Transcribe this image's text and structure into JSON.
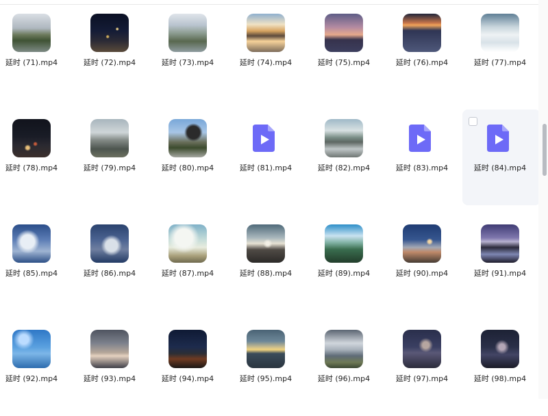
{
  "files": [
    {
      "name": "延时 (71).mp4",
      "kind": "thumb",
      "bg": "linear-gradient(180deg,#d9dee4 0%,#aeb7bf 38%,#6c7a5c 55%,#3f5334 70%,#7d8a84 100%)"
    },
    {
      "name": "延时 (72).mp4",
      "kind": "thumb",
      "bg": "radial-gradient(circle at 45% 60%,#c9a85b 0 3%,transparent 6%),radial-gradient(circle at 70% 40%,#e7cc86 0 2%,transparent 5%),linear-gradient(180deg,#0b1024 0%,#141c36 45%,#2a2a35 70%,#5a4a3a 100%)"
    },
    {
      "name": "延时 (73).mp4",
      "kind": "thumb",
      "bg": "linear-gradient(180deg,#dfe4ea 0%,#b9c4cf 30%,#8a9a8d 52%,#59684f 72%,#8f9ca0 100%)"
    },
    {
      "name": "延时 (74).mp4",
      "kind": "thumb",
      "bg": "linear-gradient(180deg,#8fb0cf 0%,#f0e2c4 28%,#d7a461 45%,#5c4a3c 58%,#f6d29a 72%,#7c6b5a 100%)"
    },
    {
      "name": "延时 (75).mp4",
      "kind": "thumb",
      "bg": "linear-gradient(180deg,#5e5d86 0%,#b28aa1 35%,#e7a98c 55%,#36324c 68%,#3d3f5e 100%)"
    },
    {
      "name": "延时 (76).mp4",
      "kind": "thumb",
      "bg": "linear-gradient(180deg,#20253a 0%,#c5744a 24%,#f1a45a 30%,#2f3554 44%,#4e587a 100%)"
    },
    {
      "name": "延时 (77).mp4",
      "kind": "thumb",
      "bg": "linear-gradient(180deg,#5f7f96 0%,#c9d6dd 35%,#eef2f4 55%,#d8e2e8 75%,#ffffff 100%)"
    },
    {
      "name": "延时 (78).mp4",
      "kind": "thumb",
      "bg": "radial-gradient(circle at 40% 75%,#e9c07a 0 4%,transparent 9%),radial-gradient(circle at 60% 65%,#c65b3a 0 3%,transparent 7%),linear-gradient(180deg,#11131c 0%,#191c26 45%,#2b2a31 70%,#3b2f2c 100%)"
    },
    {
      "name": "延时 (79).mp4",
      "kind": "thumb",
      "bg": "linear-gradient(180deg,#a8b5bd 0%,#cfd6d8 35%,#838a86 55%,#4d554f 78%,#6c7060 100%)"
    },
    {
      "name": "延时 (80).mp4",
      "kind": "thumb",
      "bg": "radial-gradient(circle at 65% 35%,#2b2b2b 0 18%,transparent 26%),linear-gradient(180deg,#79a7d8 0%,#a8c6e6 35%,#6a6f5b 60%,#3c4b2e 75%,#a5a7a0 100%)"
    },
    {
      "name": "延时 (81).mp4",
      "kind": "video"
    },
    {
      "name": "延时 (82).mp4",
      "kind": "thumb",
      "bg": "linear-gradient(180deg,#9fb9c7 0%,#d8e1e2 30%,#7b8f88 48%,#5d6662 60%,#bfc6c7 78%,#6f7673 100%)"
    },
    {
      "name": "延时 (83).mp4",
      "kind": "video"
    },
    {
      "name": "延时 (84).mp4",
      "kind": "video",
      "hover": true
    },
    {
      "name": "延时 (85).mp4",
      "kind": "thumb",
      "bg": "radial-gradient(circle at 40% 45%,#e8eef5 0 22%,transparent 38%),linear-gradient(180deg,#2b4e8a 0%,#5c7db5 40%,#9fb4d2 70%,#2c4f86 100%)"
    },
    {
      "name": "延时 (86).mp4",
      "kind": "thumb",
      "bg": "radial-gradient(circle at 55% 55%,#d9e0e8 0 20%,transparent 35%),linear-gradient(180deg,#2a426e 0%,#4b6391 40%,#6f7fa0 65%,#223a64 100%)"
    },
    {
      "name": "延时 (87).mp4",
      "kind": "thumb",
      "bg": "radial-gradient(circle at 40% 35%,#f4f6f2 0 26%,transparent 45%),linear-gradient(180deg,#7fb1c8 0%,#c6ddd9 40%,#e8ecde 60%,#a9a07b 82%,#6f6a4e 100%)"
    },
    {
      "name": "延时 (88).mp4",
      "kind": "thumb",
      "bg": "radial-gradient(circle at 55% 50%,#f3f0e6 0 6%,transparent 16%),linear-gradient(180deg,#4f6a7a 0%,#a9b7bd 35%,#e6e1d3 50%,#4f4a45 66%,#2c2a28 100%)"
    },
    {
      "name": "延时 (89).mp4",
      "kind": "thumb",
      "bg": "linear-gradient(180deg,#2d8ec9 0%,#c9e2f0 30%,#7fb0a2 48%,#3a6d4f 65%,#223d2b 100%)"
    },
    {
      "name": "延时 (90).mp4",
      "kind": "thumb",
      "bg": "radial-gradient(circle at 70% 45%,#f3d6a3 0 4%,transparent 10%),linear-gradient(180deg,#1f3c73 0%,#36568f 40%,#a3a8b4 60%,#c08a6a 72%,#453b33 100%)"
    },
    {
      "name": "延时 (91).mp4",
      "kind": "thumb",
      "bg": "linear-gradient(180deg,#3f3c74 0%,#7f77ad 35%,#b7b1cf 45%,#2c2a3b 60%,#7d86b2 78%,#1e1c2a 100%)"
    },
    {
      "name": "延时 (92).mp4",
      "kind": "thumb",
      "bg": "radial-gradient(circle at 30% 25%,#bcdcff 0 12%,transparent 26%),linear-gradient(180deg,#2f78c7 0%,#5aa0df 45%,#7cb6e8 62%,#2d6cae 100%)"
    },
    {
      "name": "延时 (93).mp4",
      "kind": "thumb",
      "bg": "linear-gradient(180deg,#4f5460 0%,#7c818c 35%,#b6a79a 60%,#e5d1c0 68%,#3f4048 100%)"
    },
    {
      "name": "延时 (94).mp4",
      "kind": "thumb",
      "bg": "linear-gradient(180deg,#0f1a34 0%,#1d2b4d 45%,#2b2e35 62%,#6f3b22 76%,#1b1715 100%)"
    },
    {
      "name": "延时 (95).mp4",
      "kind": "thumb",
      "bg": "linear-gradient(180deg,#4a6375 0%,#6d8798 30%,#cfbf8c 46%,#f1d37e 52%,#3b4c5a 62%,#2a3540 100%)"
    },
    {
      "name": "延时 (96).mp4",
      "kind": "thumb",
      "bg": "linear-gradient(180deg,#5b6572 0%,#d0d6dc 35%,#a8b1bb 52%,#5f6b77 68%,#6f7a56 85%,#3b4633 100%)"
    },
    {
      "name": "延时 (97).mp4",
      "kind": "thumb",
      "bg": "radial-gradient(circle at 60% 40%,#b6a6a0 0 10%,transparent 22%),linear-gradient(180deg,#2a2f4c 0%,#3a3f62 45%,#5a5877 60%,#2b2b3b 100%)"
    },
    {
      "name": "延时 (98).mp4",
      "kind": "thumb",
      "bg": "radial-gradient(circle at 55% 45%,#b3a6b6 0 10%,transparent 24%),linear-gradient(180deg,#1d2235 0%,#2a2f48 45%,#434565 65%,#1a1b27 100%)"
    }
  ],
  "video_icon": {
    "accent": "#6d6af7",
    "fold": "#a7a6fb",
    "play": "#ffffff"
  },
  "ui": {
    "hover_bg": "#f3f5f9",
    "scroll_thumb": "#b9bcc2"
  }
}
